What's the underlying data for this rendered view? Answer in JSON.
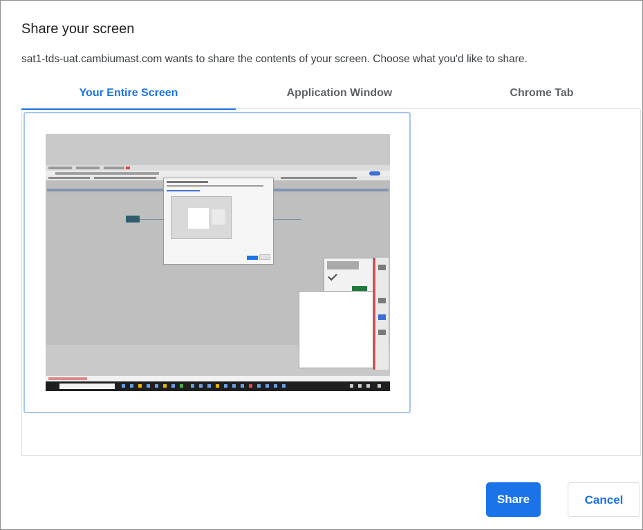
{
  "dialog": {
    "title": "Share your screen",
    "subtitle": "sat1-tds-uat.cambiumast.com wants to share the contents of your screen. Choose what you'd like to share."
  },
  "tabs": [
    {
      "label": "Your Entire Screen",
      "active": true
    },
    {
      "label": "Application Window",
      "active": false
    },
    {
      "label": "Chrome Tab",
      "active": false
    }
  ],
  "sources": [
    {
      "type": "entire-screen",
      "selected": true
    }
  ],
  "buttons": {
    "share_label": "Share",
    "cancel_label": "Cancel"
  },
  "colors": {
    "accent": "#1a73e8",
    "tile_border": "#a7c4ef",
    "divider": "#dadce0"
  }
}
